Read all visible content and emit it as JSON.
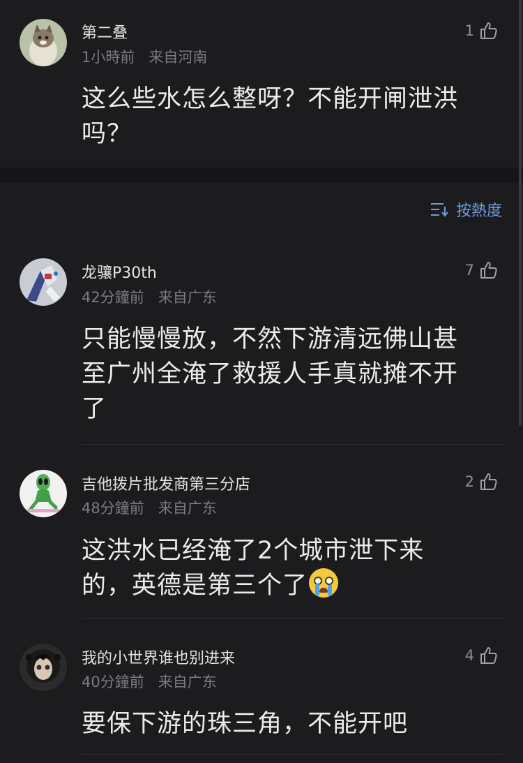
{
  "sort": {
    "label": "按熱度",
    "icon": "sort-lines-icon",
    "color": "#6d9dd8"
  },
  "comments": [
    {
      "username": "第二叠",
      "time": "1小時前",
      "location": "来自河南",
      "likes": "1",
      "text_lines": [
        "这么些水怎么整呀？不能开闸泄洪",
        "吗？"
      ],
      "avatar": "cat-avatar"
    },
    {
      "username": "龙骧P30th",
      "time": "42分鐘前",
      "location": "来自广东",
      "likes": "7",
      "text_lines": [
        "只能慢慢放，不然下游清远佛山甚",
        "至广州全淹了救援人手真就摊不开",
        "了"
      ],
      "avatar": "robot-avatar"
    },
    {
      "username": "吉他拨片批发商第三分店",
      "time": "48分鐘前",
      "location": "来自广东",
      "likes": "2",
      "text_lines": [
        "这洪水已经淹了2个城市泄下来",
        "的，英德是第三个了"
      ],
      "emoji": "crying-face-emoji",
      "avatar": "alien-skater-avatar"
    },
    {
      "username": "我的小世界谁也别进来",
      "time": "40分鐘前",
      "location": "来自广东",
      "likes": "4",
      "text_lines": [
        "要保下游的珠三角，不能开吧"
      ],
      "avatar": "anime-girl-avatar"
    }
  ]
}
